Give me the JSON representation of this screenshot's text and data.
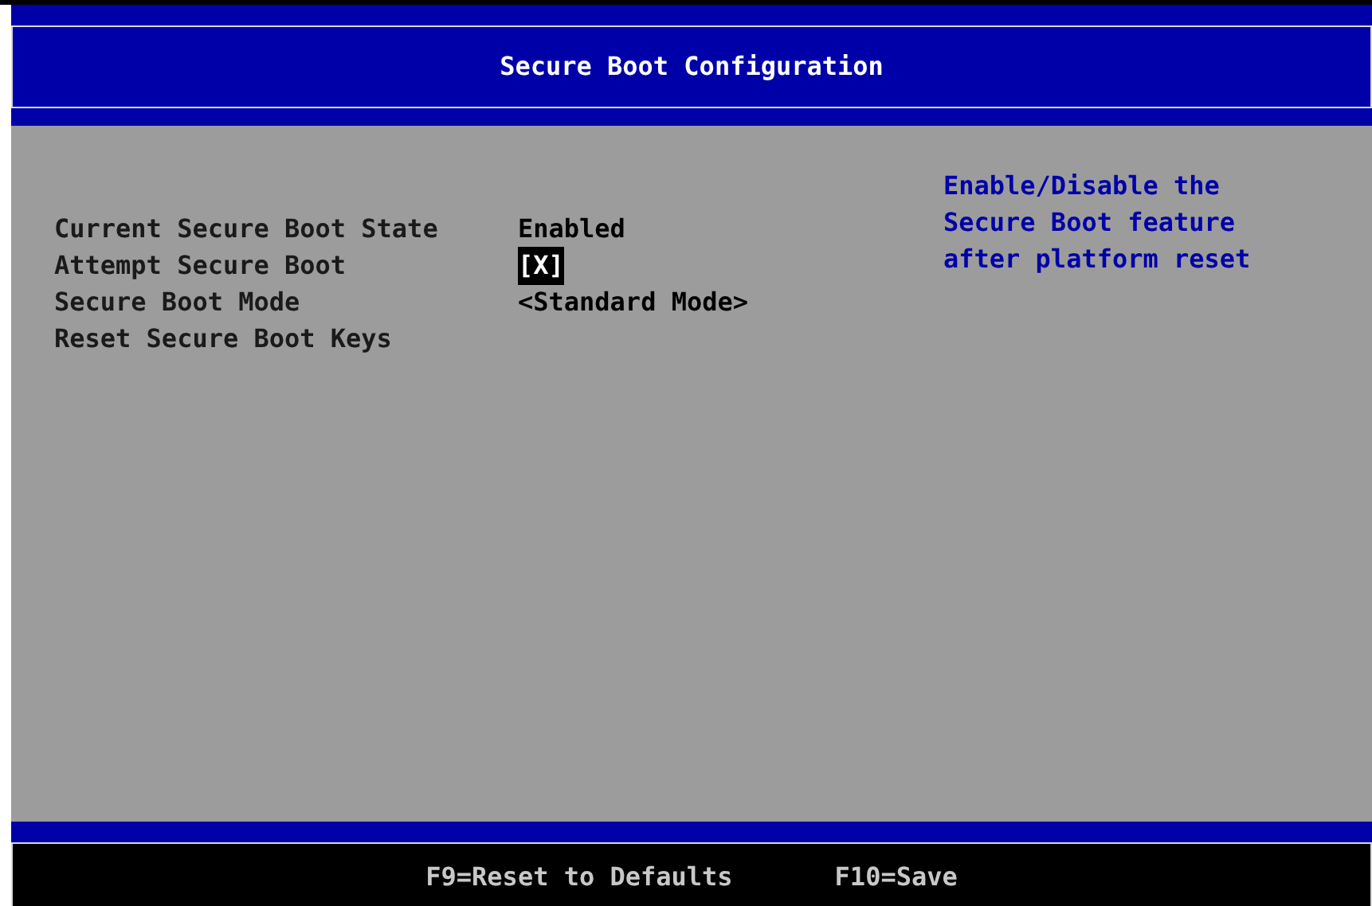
{
  "header": {
    "title": "Secure Boot Configuration"
  },
  "items": [
    {
      "kind": "info",
      "label": "Current Secure Boot State",
      "value": "Enabled",
      "selected": false
    },
    {
      "kind": "checkbox",
      "label": "Attempt Secure Boot",
      "value": "[X]",
      "checked": true,
      "selected": true
    },
    {
      "kind": "option",
      "label": "Secure Boot Mode",
      "value": "<Standard Mode>",
      "selected": false
    },
    {
      "kind": "action",
      "label": "Reset Secure Boot Keys",
      "selected": false
    }
  ],
  "help_text": "Enable/Disable the Secure Boot feature after platform reset",
  "footer": {
    "keys": [
      "F9=Reset to Defaults",
      "F10=Save"
    ]
  }
}
